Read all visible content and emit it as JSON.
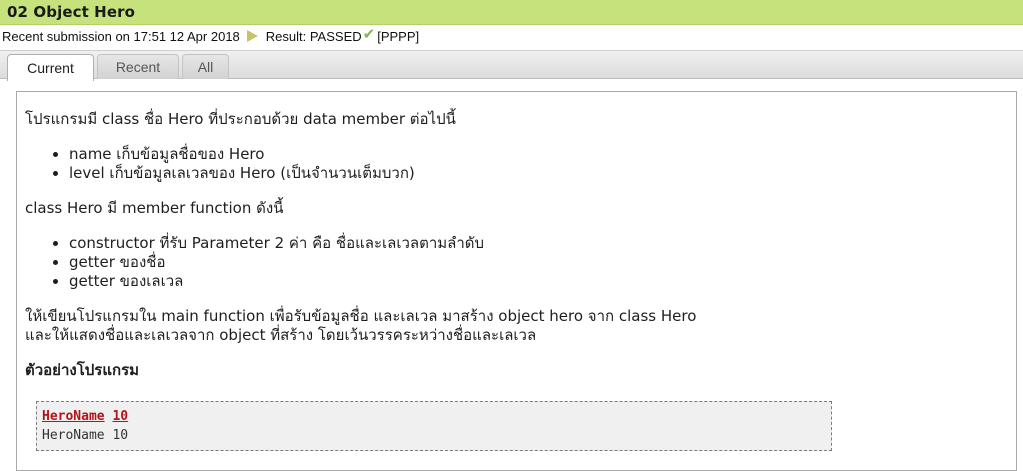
{
  "problem": {
    "title": "02 Object Hero"
  },
  "submission": {
    "prefix": "Recent submission on ",
    "time": "17:51 12 Apr 2018",
    "result_label": "Result: PASSED",
    "score": "[PPPP]"
  },
  "tabs": [
    {
      "label": "Current",
      "active": true
    },
    {
      "label": "Recent",
      "active": false
    },
    {
      "label": "All",
      "active": false
    }
  ],
  "statement": {
    "intro": "โปรแกรมมี class ชื่อ Hero ที่ประกอบด้วย data member ต่อไปนี้",
    "members": [
      "name เก็บข้อมูลชื่อของ Hero",
      "level เก็บข้อมูลเลเวลของ Hero (เป็นจำนวนเต็มบวก)"
    ],
    "functions_intro": "class Hero มี member function ดังนี้",
    "functions": [
      "constructor ที่รับ Parameter 2 ค่า คือ ชื่อและเลเวลตามลำดับ",
      "getter ของชื่อ",
      "getter ของเลเวล"
    ],
    "task_line1": "ให้เขียนโปรแกรมใน main function เพื่อรับข้อมูลชื่อ และเลเวล มาสร้าง object hero จาก class Hero",
    "task_line2": "และให้แสดงชื่อและเลเวลจาก object ที่สร้าง โดยเว้นวรรคระหว่างชื่อและเลเวล",
    "example_heading": "ตัวอย่างโปรแกรม"
  },
  "example": {
    "input_name": "HeroName",
    "input_level": "10",
    "output": "HeroName 10"
  },
  "colors": {
    "title_bar": "#c5e27c",
    "input_text": "#b3141c",
    "check": "#87b848"
  }
}
